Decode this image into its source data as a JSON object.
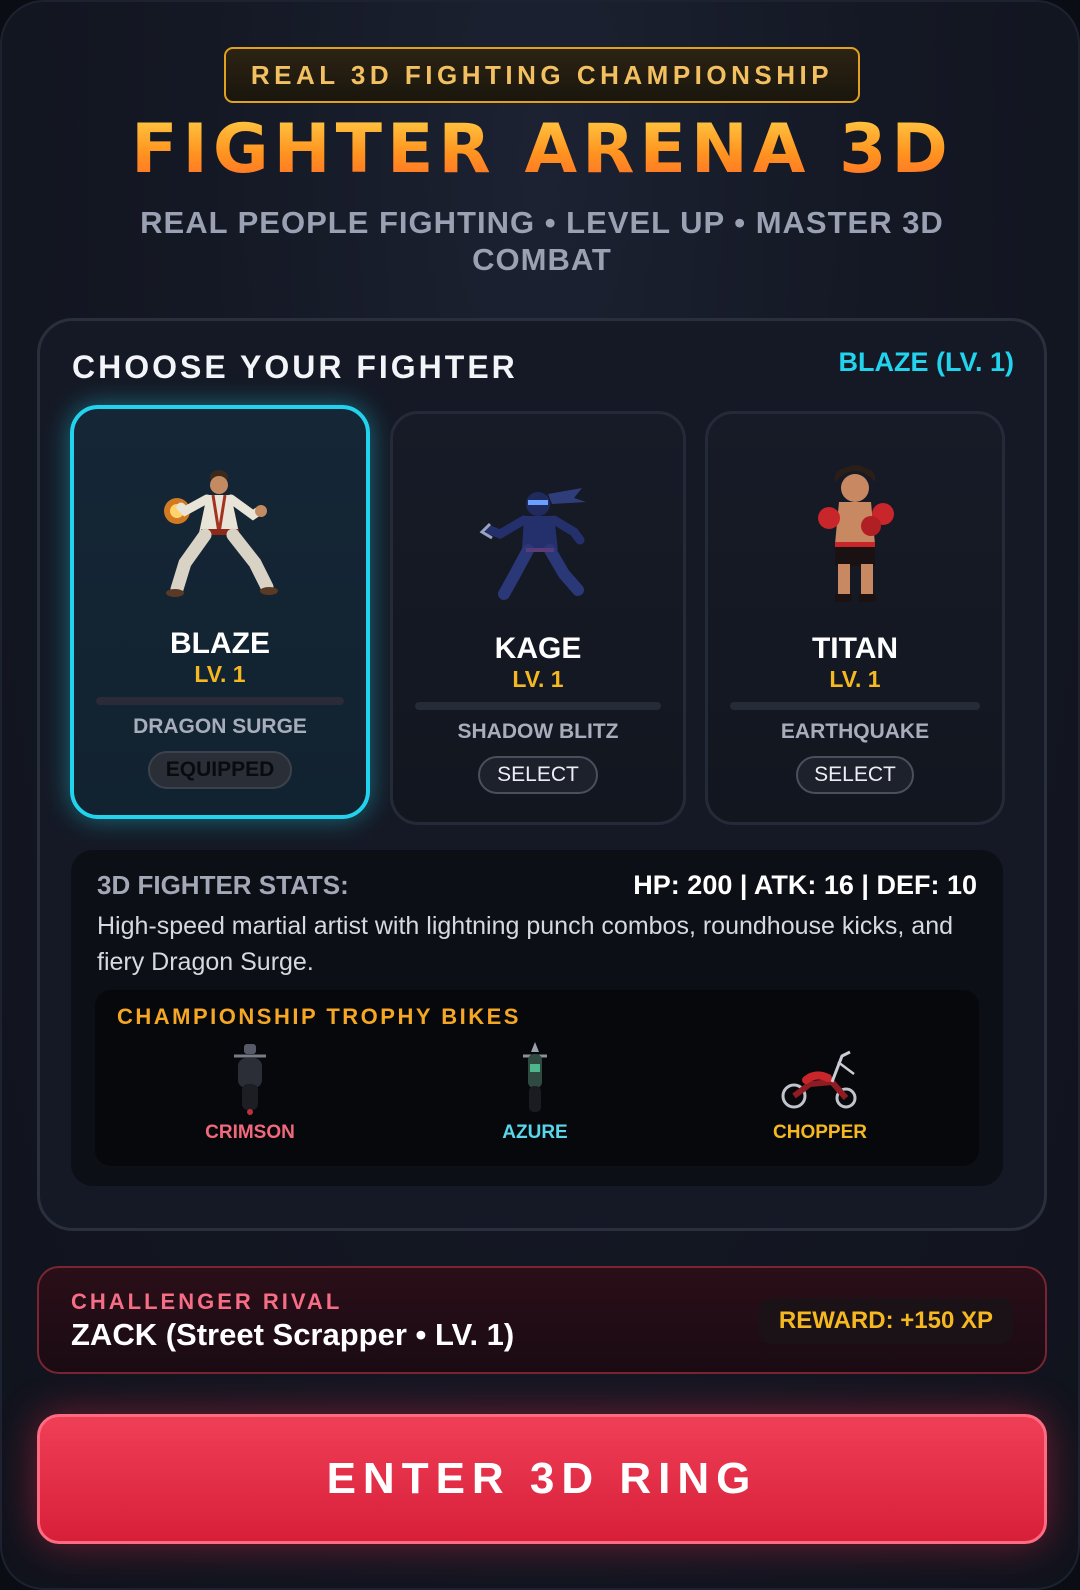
{
  "header": {
    "badge": "REAL 3D FIGHTING CHAMPIONSHIP",
    "title": "FIGHTER ARENA 3D",
    "tagline": "REAL PEOPLE FIGHTING • LEVEL UP • MASTER 3D COMBAT"
  },
  "fighter_panel": {
    "title": "CHOOSE YOUR FIGHTER",
    "selected": "BLAZE (LV. 1)",
    "fighters": [
      {
        "name": "BLAZE",
        "level": "LV. 1",
        "move": "DRAGON SURGE",
        "button": "EQUIPPED",
        "icon": "martial-artist-sprite"
      },
      {
        "name": "KAGE",
        "level": "LV. 1",
        "move": "SHADOW BLITZ",
        "button": "SELECT",
        "icon": "ninja-sprite"
      },
      {
        "name": "TITAN",
        "level": "LV. 1",
        "move": "EARTHQUAKE",
        "button": "SELECT",
        "icon": "boxer-sprite"
      }
    ],
    "stats": {
      "label": "3D FIGHTER STATS:",
      "values": "HP: 200 | ATK: 16 | DEF: 10",
      "description": "High-speed martial artist with lightning punch combos, roundhouse kicks, and fiery Dragon Surge."
    },
    "bikes": {
      "title": "CHAMPIONSHIP TROPHY BIKES",
      "items": [
        {
          "name": "CRIMSON",
          "color": "#f2697d",
          "icon": "motorcycle-front-icon"
        },
        {
          "name": "AZURE",
          "color": "#5ad6ea",
          "icon": "motorcycle-front-icon"
        },
        {
          "name": "CHOPPER",
          "color": "#f5b820",
          "icon": "chopper-motorcycle-icon"
        }
      ]
    }
  },
  "rival": {
    "label": "CHALLENGER RIVAL",
    "name": "ZACK (Street Scrapper • LV. 1)",
    "reward": "REWARD: +150 XP"
  },
  "cta": {
    "label": "ENTER 3D RING"
  },
  "colors": {
    "accent_cyan": "#22d3ee",
    "gold": "#f5b820",
    "cta_red": "#e52e47"
  }
}
